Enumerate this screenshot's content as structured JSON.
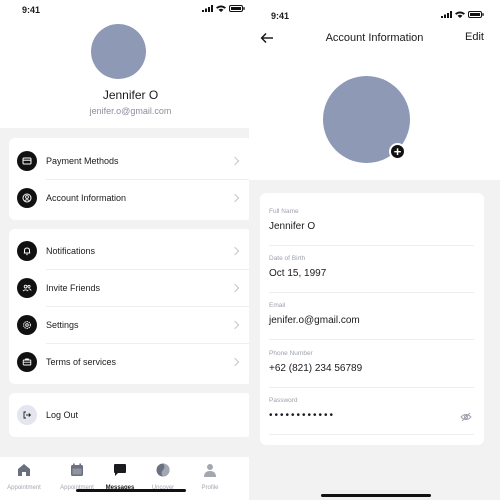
{
  "status": {
    "time": "9:41"
  },
  "profile": {
    "name": "Jennifer O",
    "email": "jenifer.o@gmail.com",
    "avatar": "avatar"
  },
  "menu_group_1": [
    {
      "label": "Payment Methods",
      "icon": "card-icon"
    },
    {
      "label": "Account Information",
      "icon": "user-icon"
    }
  ],
  "menu_group_2": [
    {
      "label": "Notifications",
      "icon": "bell-icon"
    },
    {
      "label": "Invite Friends",
      "icon": "people-icon"
    },
    {
      "label": "Settings",
      "icon": "gear-icon"
    },
    {
      "label": "Terms of services",
      "icon": "briefcase-icon"
    }
  ],
  "logout": {
    "label": "Log Out",
    "icon": "logout-icon"
  },
  "tabs": [
    {
      "label": "Appointment",
      "icon": "home-icon"
    },
    {
      "label": "Appointment",
      "icon": "calendar-icon"
    },
    {
      "label": "Messages",
      "icon": "chat-icon",
      "active": true
    },
    {
      "label": "Uncover",
      "icon": "compass-icon"
    },
    {
      "label": "Profile",
      "icon": "person-icon"
    }
  ],
  "account": {
    "title": "Account Information",
    "edit_label": "Edit",
    "add_symbol": "+",
    "fields": [
      {
        "label": "Full Name",
        "value": "Jennifer O"
      },
      {
        "label": "Date of Birth",
        "value": "Oct 15, 1997"
      },
      {
        "label": "Email",
        "value": "jenifer.o@gmail.com"
      },
      {
        "label": "Phone Number",
        "value": "+62 (821) 234 56789"
      },
      {
        "label": "Password",
        "value": "••••••••••••"
      }
    ]
  },
  "colors": {
    "avatar": "#8e9ab5",
    "accent": "#111111",
    "muted": "#9ea2ad"
  }
}
